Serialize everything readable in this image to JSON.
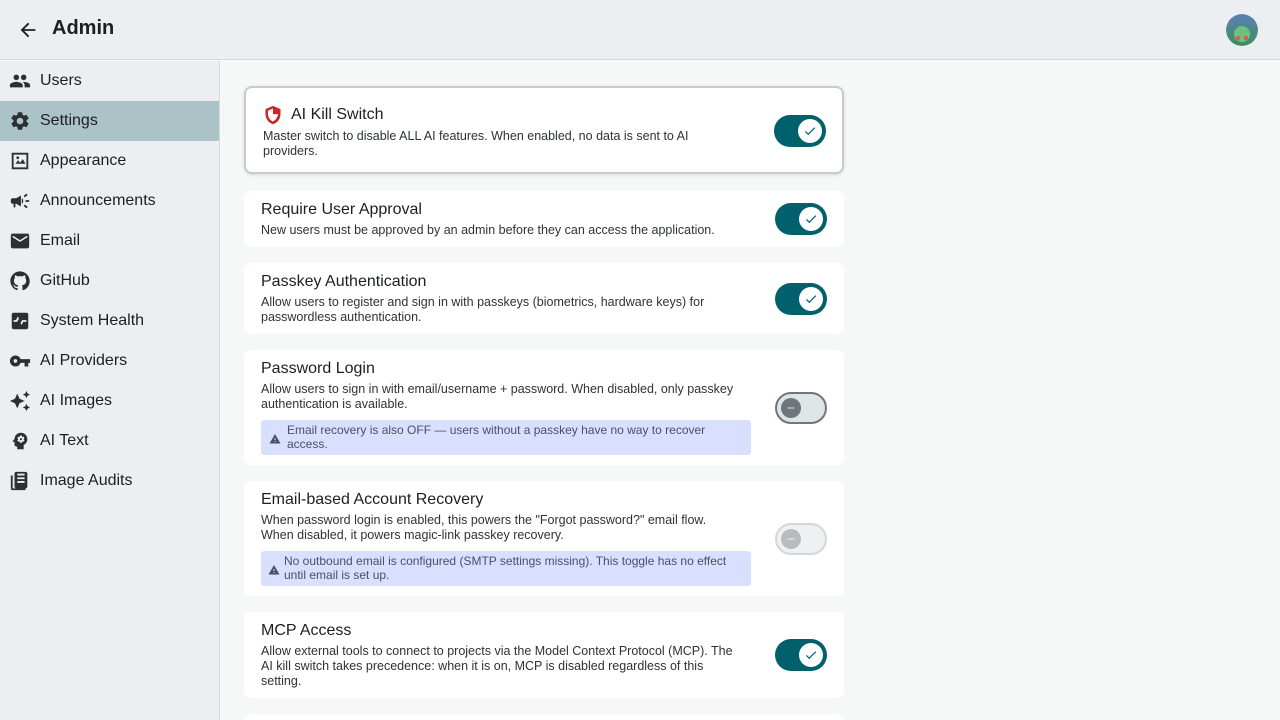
{
  "header": {
    "title": "Admin"
  },
  "sidebar": {
    "items": [
      {
        "label": "Users",
        "icon": "users-icon"
      },
      {
        "label": "Settings",
        "icon": "gear-icon",
        "active": true
      },
      {
        "label": "Appearance",
        "icon": "appearance-icon"
      },
      {
        "label": "Announcements",
        "icon": "megaphone-icon"
      },
      {
        "label": "Email",
        "icon": "mail-icon"
      },
      {
        "label": "GitHub",
        "icon": "github-icon"
      },
      {
        "label": "System Health",
        "icon": "heartbeat-icon"
      },
      {
        "label": "AI Providers",
        "icon": "key-icon"
      },
      {
        "label": "AI Images",
        "icon": "sparkles-icon"
      },
      {
        "label": "AI Text",
        "icon": "psychology-icon"
      },
      {
        "label": "Image Audits",
        "icon": "document-icon"
      }
    ]
  },
  "settings": [
    {
      "title": "AI Kill Switch",
      "description": "Master switch to disable ALL AI features. When enabled, no data is sent to AI providers.",
      "state": "on",
      "icon": "shield-icon"
    },
    {
      "title": "Require User Approval",
      "description": "New users must be approved by an admin before they can access the application.",
      "state": "on"
    },
    {
      "title": "Passkey Authentication",
      "description": "Allow users to register and sign in with passkeys (biometrics, hardware keys) for passwordless authentication.",
      "state": "on"
    },
    {
      "title": "Password Login",
      "description": "Allow users to sign in with email/username + password. When disabled, only passkey authentication is available.",
      "state": "off",
      "notice": "Email recovery is also OFF — users without a passkey have no way to recover access."
    },
    {
      "title": "Email-based Account Recovery",
      "description": "When password login is enabled, this powers the \"Forgot password?\" email flow. When disabled, it powers magic-link passkey recovery.",
      "state": "disabled",
      "notice": "No outbound email is configured (SMTP settings missing). This toggle has no effect until email is set up."
    },
    {
      "title": "MCP Access",
      "description": "Allow external tools to connect to projects via the Model Context Protocol (MCP). The AI kill switch takes precedence: when it is on, MCP is disabled regardless of this setting.",
      "state": "on"
    }
  ],
  "colors": {
    "accent": "#00616c",
    "active_nav": "#abc2c6",
    "notice_bg": "#d9e0ff",
    "shield": "#c62828"
  }
}
